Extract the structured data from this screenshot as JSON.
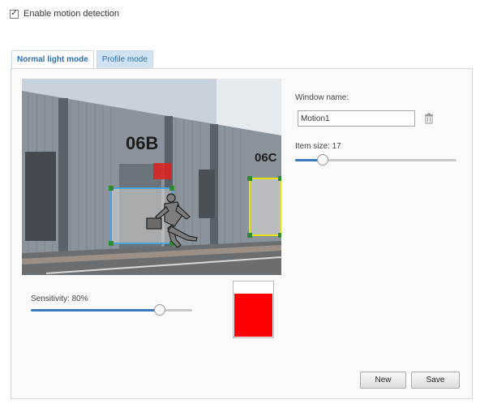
{
  "motion_detection": {
    "enabled": true,
    "checkbox_mark": "✓",
    "label": "Enable motion detection"
  },
  "tabs": [
    {
      "label": "Normal light mode",
      "active": true
    },
    {
      "label": "Profile mode",
      "active": false
    }
  ],
  "preview": {
    "building_labels": [
      "06B",
      "06C"
    ],
    "window_colors": {
      "selected": "#4aa3df",
      "second": "#e5e010",
      "handles": "#2e8b2e",
      "alert": "#e02020"
    }
  },
  "sensitivity": {
    "label": "Sensitivity: 80%",
    "value_percent": 80
  },
  "motion_indicator": {
    "level_percent": 80,
    "color": "#ff0000"
  },
  "window_settings": {
    "name_label": "Window name:",
    "name_value": "Motion1",
    "delete_icon": "trash-icon",
    "item_size_label": "Item size: 17",
    "item_size_percent": 17
  },
  "buttons": {
    "new_label": "New",
    "save_label": "Save"
  },
  "colors": {
    "accent": "#3a79c0",
    "tab_inactive_bg": "#cfe3f2"
  }
}
